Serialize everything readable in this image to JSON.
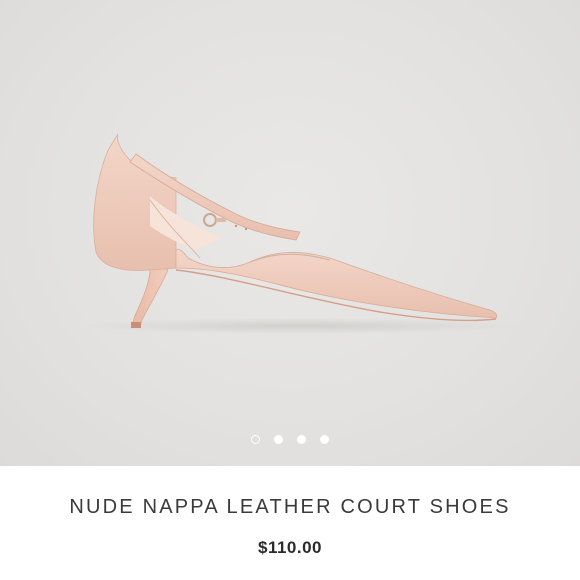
{
  "product": {
    "title": "NUDE NAPPA LEATHER COURT SHOES",
    "price": "$110.00"
  },
  "carousel": {
    "total_images": 4,
    "active_index": 0
  },
  "colors": {
    "background": "#e3e2e0",
    "shoe": "#f1cfc0",
    "dot": "#ffffff",
    "title_text": "#3a3a3a",
    "price_text": "#2b2b2b"
  },
  "icons": {
    "product_image": "pink-pointed-kitten-heel-shoe"
  }
}
